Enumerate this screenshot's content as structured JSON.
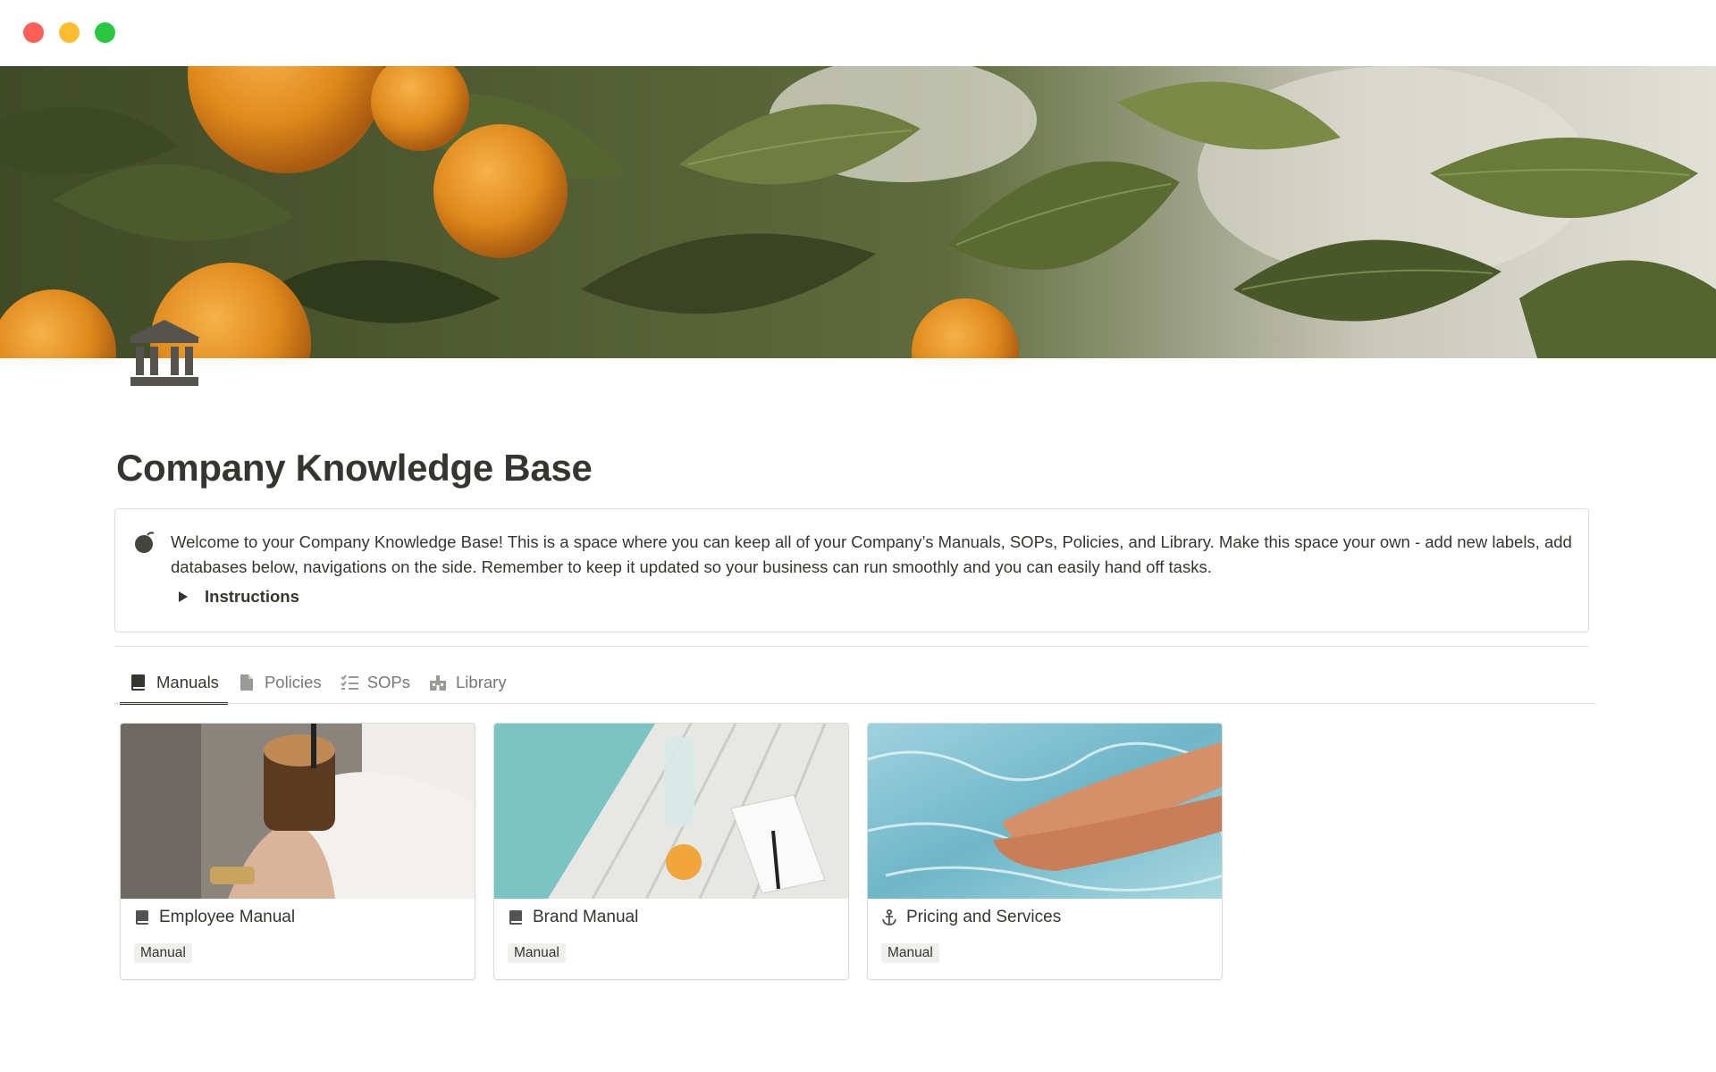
{
  "window": {
    "controls": [
      "close",
      "minimize",
      "zoom"
    ]
  },
  "page": {
    "icon": "bank-building-icon",
    "title": "Company Knowledge Base"
  },
  "callout": {
    "icon": "bomb-icon",
    "text": "Welcome to your Company Knowledge Base! This is a space where you can keep all of your Company’s Manuals, SOPs, Policies, and Library. Make this space your own - add new labels, add databases below, navigations on the side. Remember to keep it updated so your business can run smoothly and you can easily hand off tasks.",
    "toggle_label": "Instructions"
  },
  "tabs": [
    {
      "label": "Manuals",
      "icon": "book-icon",
      "active": true
    },
    {
      "label": "Policies",
      "icon": "document-icon",
      "active": false
    },
    {
      "label": "SOPs",
      "icon": "checklist-icon",
      "active": false
    },
    {
      "label": "Library",
      "icon": "library-building-icon",
      "active": false
    }
  ],
  "cards": [
    {
      "title": "Employee Manual",
      "icon": "book-icon",
      "tag": "Manual"
    },
    {
      "title": "Brand Manual",
      "icon": "book-icon",
      "tag": "Manual"
    },
    {
      "title": "Pricing and Services",
      "icon": "anchor-icon",
      "tag": "Manual"
    }
  ],
  "colors": {
    "text": "#37352f",
    "muted": "#787774",
    "border": "#dcdad6",
    "tag_bg": "#efefed",
    "close": "#fe5f57",
    "minimize": "#febc2e",
    "zoom": "#28c840"
  }
}
